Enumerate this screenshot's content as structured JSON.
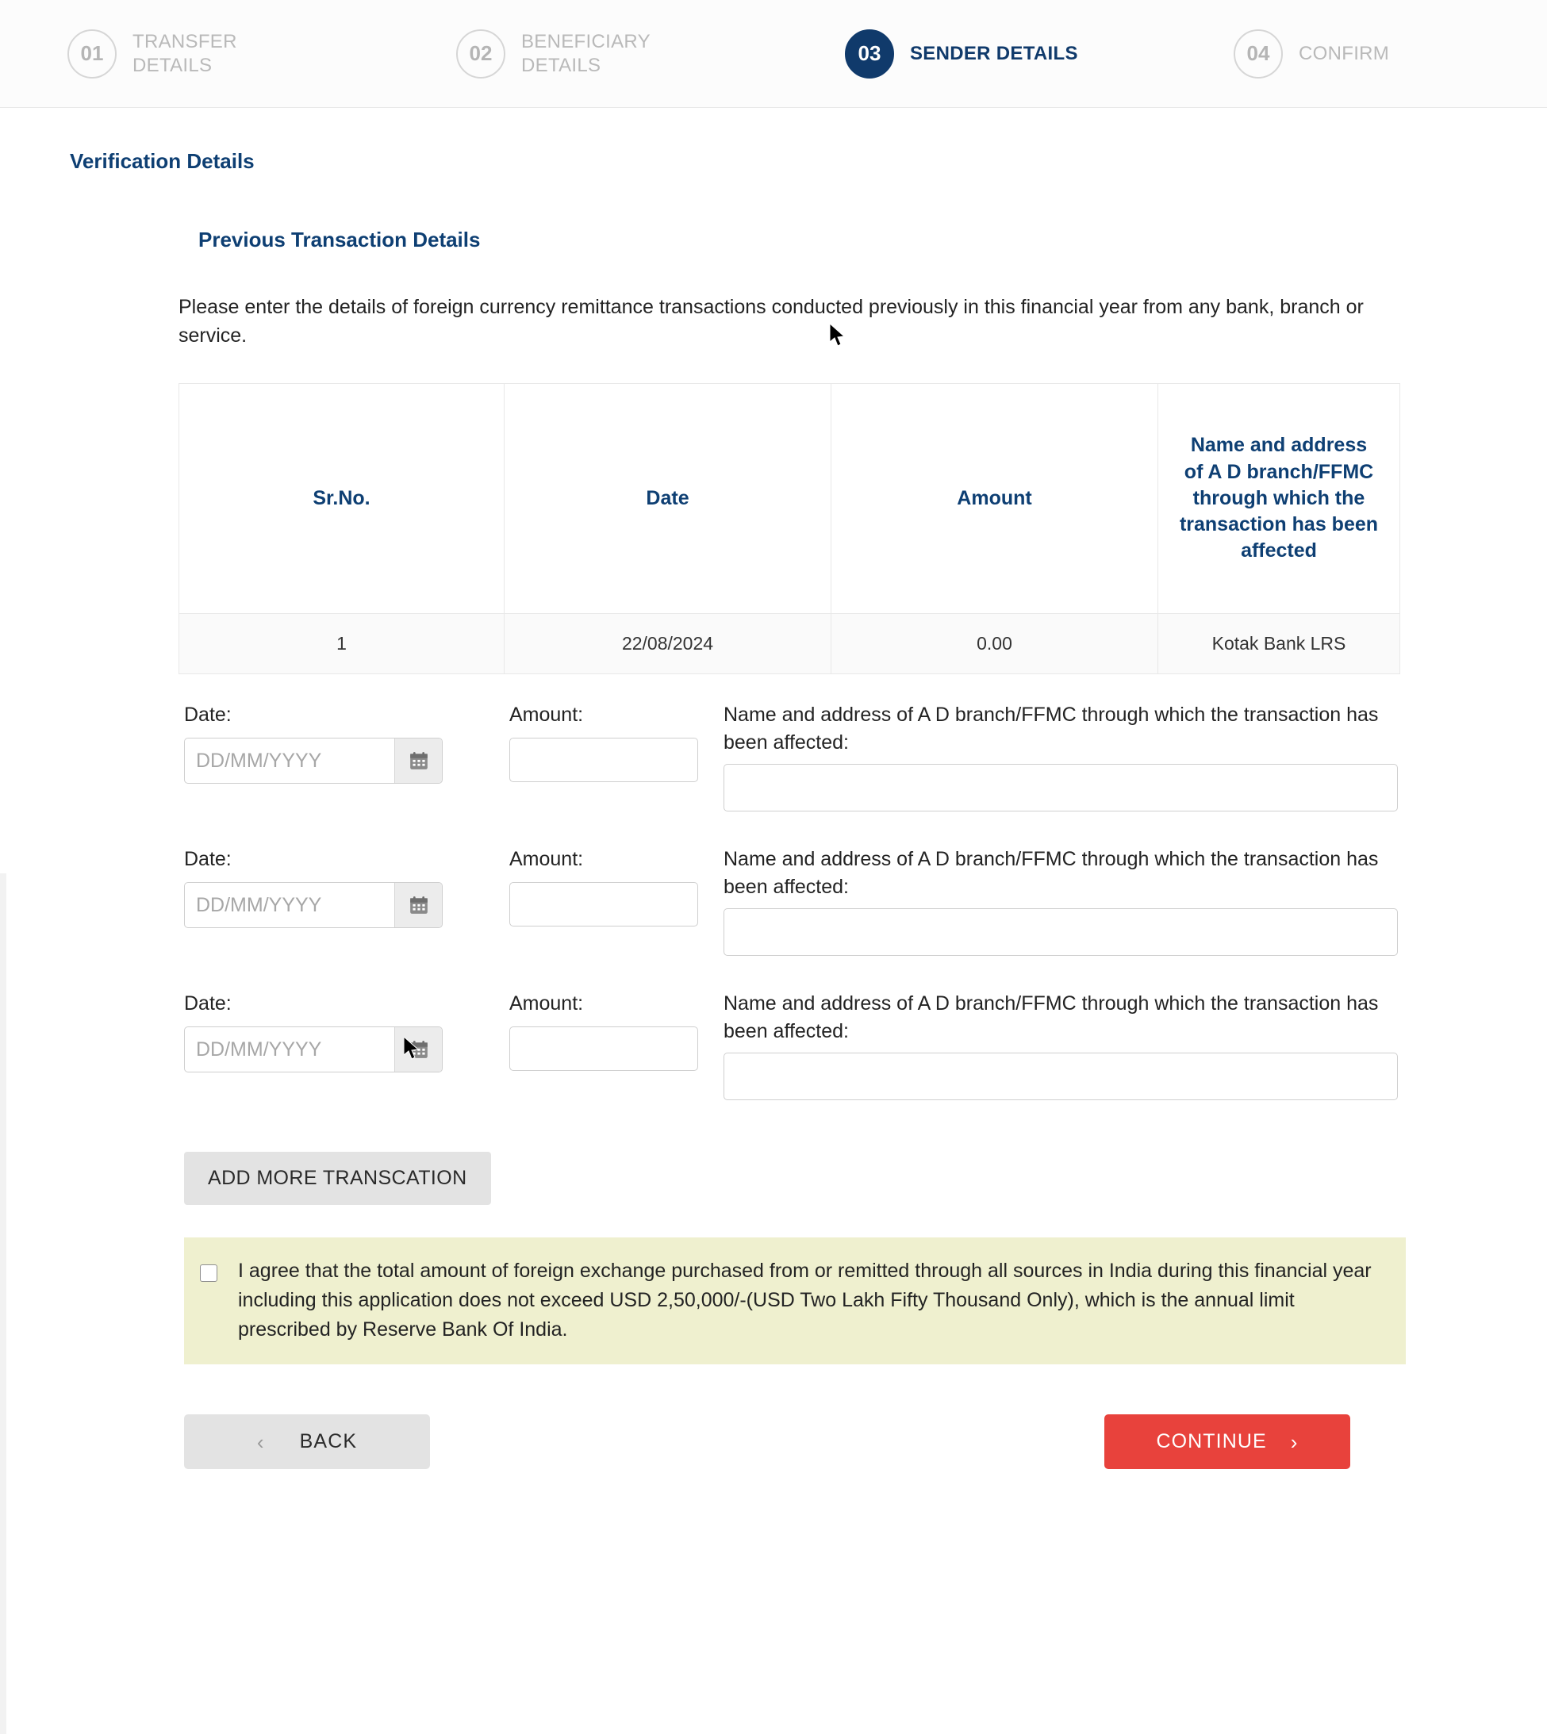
{
  "stepper": {
    "steps": [
      {
        "num": "01",
        "label": "TRANSFER DETAILS",
        "active": false
      },
      {
        "num": "02",
        "label": "BENEFICIARY DETAILS",
        "active": false
      },
      {
        "num": "03",
        "label": "SENDER DETAILS",
        "active": true
      },
      {
        "num": "04",
        "label": "CONFIRM",
        "active": false
      }
    ],
    "active_color": "#103a6b"
  },
  "page": {
    "section_title": "Verification Details",
    "sub_title": "Previous Transaction Details",
    "intro": "Please enter the details of foreign currency remittance transactions conducted previously in this financial year from any bank, branch or service."
  },
  "table": {
    "headers": [
      "Sr.No.",
      "Date",
      "Amount",
      "Name and address of A D branch/FFMC through which the transaction has been affected"
    ],
    "rows": [
      [
        "1",
        "22/08/2024",
        "0.00",
        "Kotak Bank LRS"
      ]
    ]
  },
  "form": {
    "date_label": "Date:",
    "date_placeholder": "DD/MM/YYYY",
    "date_value": "",
    "amount_label": "Amount:",
    "amount_value": "",
    "name_label": "Name and address of A D branch/FFMC through which the transaction has been affected:",
    "name_value": "",
    "calendar_icon": "calendar-icon",
    "rows": [
      {
        "date_value": "",
        "amount_value": "",
        "name_value": ""
      },
      {
        "date_value": "",
        "amount_value": "",
        "name_value": ""
      },
      {
        "date_value": "",
        "amount_value": "",
        "name_value": ""
      }
    ],
    "add_more_label": "ADD MORE TRANSCATION"
  },
  "agreement": {
    "checked": false,
    "text": "I agree that the total amount of foreign exchange purchased from or remitted through all sources in India during this financial year including this application does not exceed USD 2,50,000/-(USD Two Lakh Fifty Thousand Only), which is the annual limit prescribed by Reserve Bank Of India.",
    "background": "#eff0cf"
  },
  "footer": {
    "back_label": "BACK",
    "continue_label": "CONTINUE",
    "back_chevron": "‹",
    "continue_chevron": "›",
    "continue_color": "#e8423c"
  }
}
